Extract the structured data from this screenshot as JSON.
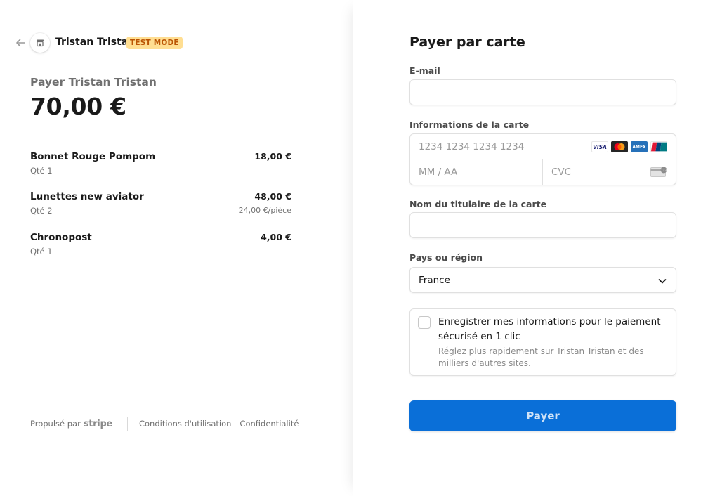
{
  "header": {
    "merchant_name": "Tristan Tristan",
    "badge": "TEST MODE"
  },
  "summary": {
    "pay_label": "Payer Tristan Tristan",
    "amount": "70,00 €"
  },
  "line_items": [
    {
      "name": "Bonnet Rouge Pompom",
      "price": "18,00 €",
      "qty": "Qté 1",
      "unit": ""
    },
    {
      "name": "Lunettes new aviator",
      "price": "48,00 €",
      "qty": "Qté 2",
      "unit": "24,00 €/pièce"
    },
    {
      "name": "Chronopost",
      "price": "4,00 €",
      "qty": "Qté 1",
      "unit": ""
    }
  ],
  "footer": {
    "powered_by": "Propulsé par",
    "brand": "stripe",
    "terms": "Conditions d'utilisation",
    "privacy": "Confidentialité"
  },
  "form": {
    "title": "Payer par carte",
    "email_label": "E-mail",
    "email_value": "",
    "card_label": "Informations de la carte",
    "card_number_placeholder": "1234 1234 1234 1234",
    "expiry_placeholder": "MM / AA",
    "cvc_placeholder": "CVC",
    "card_brands": [
      "VISA",
      "mastercard",
      "AMEX",
      "UnionPay"
    ],
    "holder_label": "Nom du titulaire de la carte",
    "holder_value": "",
    "country_label": "Pays ou région",
    "country_value": "France",
    "save_title": "Enregistrer mes informations pour le paiement sécurisé en 1 clic",
    "save_subtitle": "Réglez plus rapidement sur Tristan Tristan et des milliers d'autres sites.",
    "save_checked": false,
    "pay_button": "Payer"
  },
  "colors": {
    "accent": "#0a6fd8",
    "badge_bg": "#ffde92",
    "badge_text": "#bb5504",
    "muted_text": "#707070"
  }
}
